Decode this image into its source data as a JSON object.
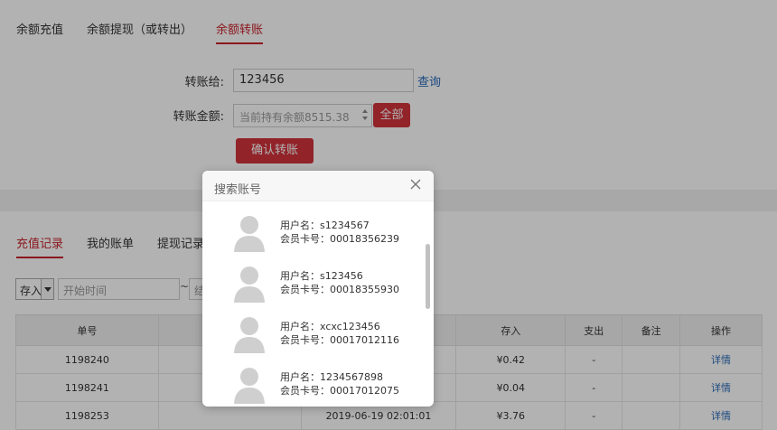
{
  "top_tabs": [
    {
      "label": "余额充值",
      "active": false
    },
    {
      "label": "余额提现（或转出）",
      "active": false
    },
    {
      "label": "余额转账",
      "active": true
    }
  ],
  "transfer": {
    "to_label": "转账给:",
    "to_value": "123456",
    "query_link": "查询",
    "amount_label": "转账金额:",
    "amount_placeholder": "当前持有余额8515.38",
    "all_button": "全部",
    "confirm_button": "确认转账"
  },
  "records_tabs": [
    {
      "label": "充值记录",
      "active": true
    },
    {
      "label": "我的账单",
      "active": false
    },
    {
      "label": "提现记录",
      "active": false
    }
  ],
  "filter": {
    "type_value": "存入",
    "start_placeholder": "开始时间",
    "end_placeholder_partial": "结",
    "separator": "~"
  },
  "table": {
    "headers": [
      "单号",
      "",
      "",
      "存入",
      "支出",
      "备注",
      "操作"
    ],
    "rows": [
      {
        "id": "1198240",
        "time": "",
        "amount": "¥0.42",
        "out": "-",
        "note": "",
        "action": "详情"
      },
      {
        "id": "1198241",
        "time": "",
        "amount": "¥0.04",
        "out": "-",
        "note": "",
        "action": "详情"
      },
      {
        "id": "1198253",
        "time": "2019-06-19 02:01:01",
        "amount": "¥3.76",
        "out": "-",
        "note": "",
        "action": "详情"
      }
    ]
  },
  "modal": {
    "title": "搜索账号",
    "username_prefix": "用户名：",
    "card_prefix": "会员卡号：",
    "users": [
      {
        "username": "s1234567",
        "card": "00018356239"
      },
      {
        "username": "s123456",
        "card": "00018355930"
      },
      {
        "username": "xcxc123456",
        "card": "00017012116"
      },
      {
        "username": "1234567898",
        "card": "00017012075"
      }
    ]
  },
  "colors": {
    "accent_red": "#c8232c",
    "button_red": "#d0333b",
    "link_blue": "#2a6ab8",
    "overlay": "rgba(0,0,0,0.30)"
  }
}
